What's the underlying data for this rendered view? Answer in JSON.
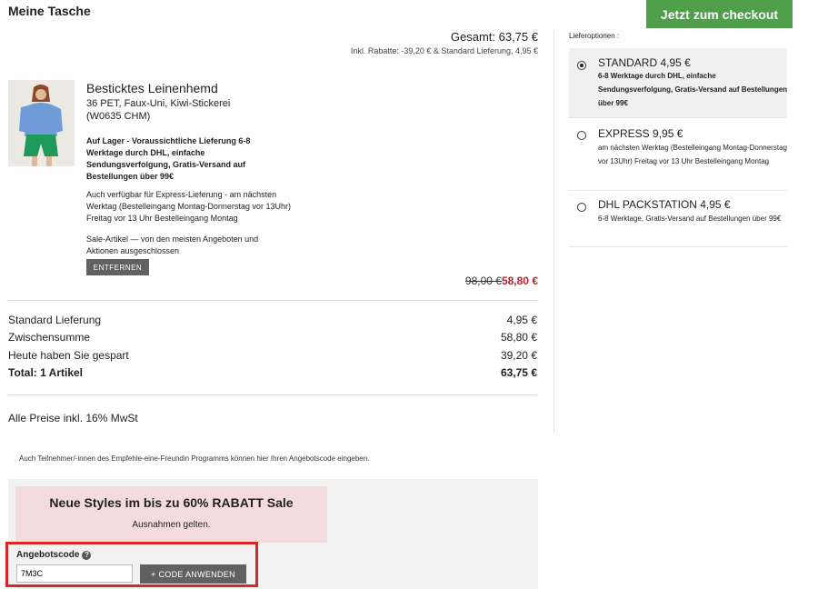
{
  "header": {
    "title": "Meine Tasche",
    "checkout_label": "Jetzt zum checkout"
  },
  "summary_top": {
    "total": "Gesamt: 63,75 €",
    "subline": "Inkl. Rabatte: -39,20 € & Standard Lieferung, 4,95 €"
  },
  "product": {
    "name": "Besticktes Leinenhemd",
    "desc_line1": "36 PET, Faux-Uni, Kiwi-Stickerei",
    "desc_line2": "(W0635 CHM)",
    "stock": "Auf Lager - Voraussichtliche Lieferung 6-8 Werktage durch DHL, einfache Sendungsverfolgung, Gratis-Versand auf Bestellungen über 99€",
    "express": "Auch verfügbar für Express-Lieferung - am nächsten Werktag (Bestelleingang Montag-Donnerstag vor 13Uhr) Freitag vor 13 Uhr Bestelleingang Montag",
    "sale_note": "Sale-Artikel — von den meisten Angeboten und Aktionen ausgeschlossen",
    "remove_label": "ENTFERNEN",
    "price_old": "98,00 €",
    "price_new": "58,80 €"
  },
  "totals": [
    {
      "label": "Standard Lieferung",
      "value": "4,95 €"
    },
    {
      "label": "Zwischensumme",
      "value": "58,80 €"
    },
    {
      "label": "Heute haben Sie gespart",
      "value": "39,20 €"
    },
    {
      "label": "Total: 1 Artikel",
      "value": "63,75 €"
    }
  ],
  "vat_note": "Alle Preise inkl. 16% MwSt",
  "referral_note": "Auch Teilnehmer/-innen des Empfehle-eine-Freundin Programms können hier Ihren Angebotscode eingeben.",
  "promo": {
    "title": "Neue Styles im bis zu 60% RABATT Sale",
    "note": "Ausnahmen gelten."
  },
  "coupon": {
    "label": "Angebotscode",
    "value": "7M3C",
    "apply_label": "+ CODE ANWENDEN"
  },
  "shipping": {
    "heading": "Lieferoptionen :",
    "options": [
      {
        "title": "STANDARD 4,95 €",
        "desc": "6-8 Werktage durch DHL, einfache Sendungsverfolgung, Gratis-Versand auf Bestellungen über 99€",
        "selected": true
      },
      {
        "title": "EXPRESS 9,95 €",
        "desc": "am nächsten Werktag (Bestelleingang Montag-Donnerstag vor 13Uhr) Freitag vor 13 Uhr Bestelleingang Montag",
        "selected": false
      },
      {
        "title": "DHL PACKSTATION 4,95 €",
        "desc": "6-8 Werktage, Gratis-Versand auf Bestellungen über 99€",
        "selected": false
      }
    ]
  },
  "colors": {
    "checkout": "#4f9e4a",
    "sale_price": "#b62227",
    "highlight": "#d9262a",
    "promo_bg": "#f5dcdc"
  }
}
